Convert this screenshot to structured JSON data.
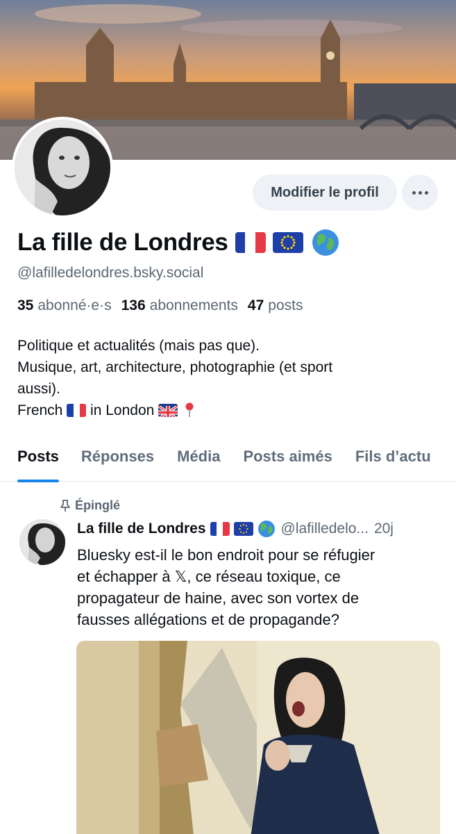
{
  "profile": {
    "display_name": "La fille de Londres",
    "handle": "@lafilledelondres.bsky.social",
    "edit_button": "Modifier le profil",
    "stats": {
      "followers_count": "35",
      "followers_label": "abonné·e·s",
      "following_count": "136",
      "following_label": "abonnements",
      "posts_count": "47",
      "posts_label": "posts"
    },
    "bio": {
      "line1": "Politique et actualités (mais pas que).",
      "line2": "Musique, art, architecture, photographie (et sport",
      "line3": "aussi).",
      "line4_a": "French",
      "line4_b": "in London"
    }
  },
  "tabs": [
    {
      "label": "Posts",
      "active": true
    },
    {
      "label": "Réponses"
    },
    {
      "label": "Média"
    },
    {
      "label": "Posts aimés"
    },
    {
      "label": "Fils d’actu"
    }
  ],
  "post": {
    "pinned_label": "Épinglé",
    "author": "La fille de Londres",
    "handle": "@lafilledelondres.bsky.social",
    "handle_truncated": "@lafilledelo...",
    "time": "20j",
    "text_line1": "Bluesky est-il le bon endroit pour se réfugier",
    "text_line2": "et échapper à 𝕏, ce réseau toxique, ce",
    "text_line3": "propagateur de haine, avec son vortex de",
    "text_line4": "fausses allégations et de propagande?"
  },
  "colors": {
    "accent": "#1a85e8",
    "text_primary": "#0b0f14",
    "text_secondary": "#5b6673",
    "button_bg": "#eef2f6",
    "flag_blue": "#1f3fa8",
    "flag_red": "#e63946"
  },
  "icons": [
    "more-horizontal-icon",
    "pin-icon",
    "location-pin-icon",
    "globe-icon",
    "flag-fr-icon",
    "flag-eu-icon",
    "flag-uk-icon"
  ]
}
